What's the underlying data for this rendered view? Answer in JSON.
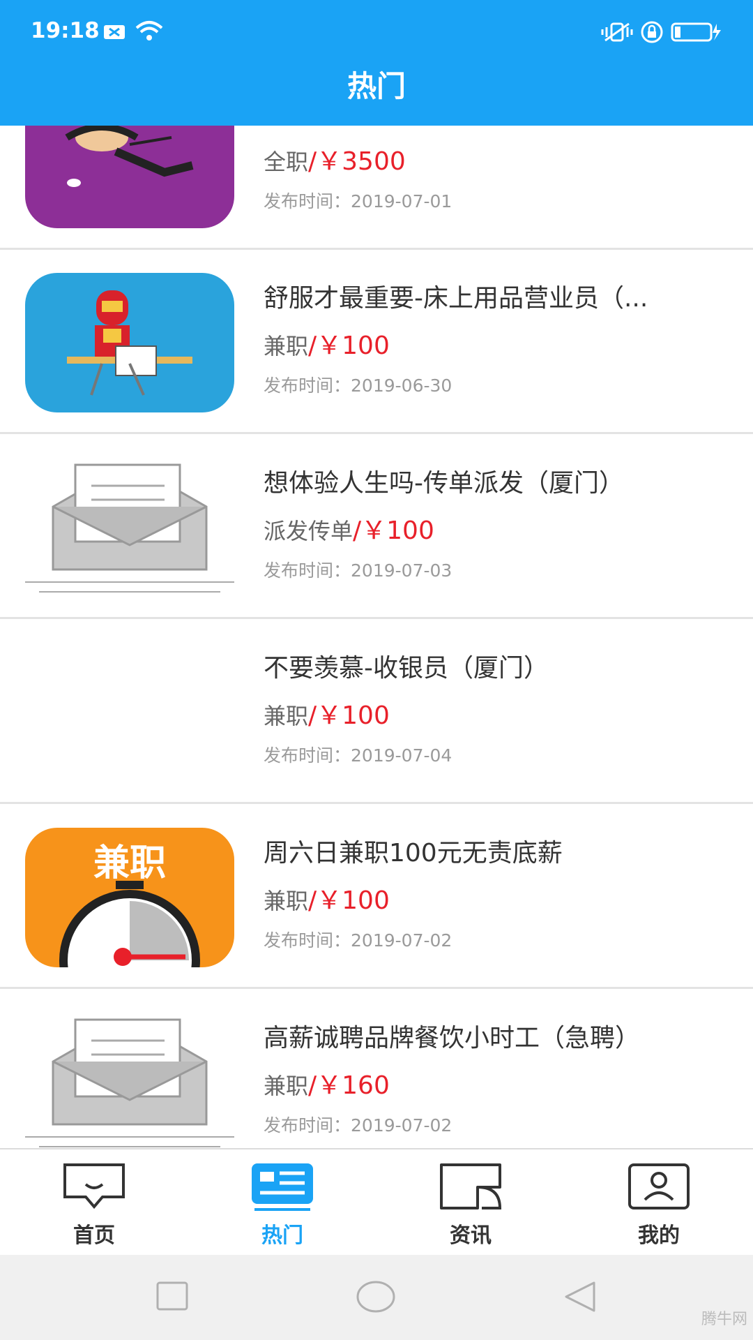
{
  "status": {
    "time": "19:18"
  },
  "header": {
    "title": "热门"
  },
  "jobs": [
    {
      "title": "",
      "type": "全职",
      "sep": "/",
      "price": "￥3500",
      "date_label": "发布时间：",
      "date": "2019-07-01",
      "thumb": "ninja-cartoon"
    },
    {
      "title": "舒服才最重要-床上用品营业员（...",
      "type": "兼职",
      "sep": "/",
      "price": "￥100",
      "date_label": "发布时间：",
      "date": "2019-06-30",
      "thumb": "ironman-ironing"
    },
    {
      "title": "想体验人生吗-传单派发（厦门）",
      "type": "派发传单",
      "sep": "/",
      "price": "￥100",
      "date_label": "发布时间：",
      "date": "2019-07-03",
      "thumb": "envelope"
    },
    {
      "title": "不要羡慕-收银员（厦门）",
      "type": "兼职",
      "sep": "/",
      "price": "￥100",
      "date_label": "发布时间：",
      "date": "2019-07-04",
      "thumb": "none"
    },
    {
      "title": "周六日兼职100元无责底薪",
      "type": "兼职",
      "sep": "/",
      "price": "￥100",
      "date_label": "发布时间：",
      "date": "2019-07-02",
      "thumb": "parttime-stopwatch",
      "thumb_text": "兼职"
    },
    {
      "title": "高薪诚聘品牌餐饮小时工（急聘）",
      "type": "兼职",
      "sep": "/",
      "price": "￥160",
      "date_label": "发布时间：",
      "date": "2019-07-02",
      "thumb": "envelope"
    }
  ],
  "tabs": [
    {
      "label": "首页",
      "icon": "chat-bubble-icon",
      "active": false
    },
    {
      "label": "热门",
      "icon": "news-card-icon",
      "active": true
    },
    {
      "label": "资讯",
      "icon": "info-window-icon",
      "active": false
    },
    {
      "label": "我的",
      "icon": "profile-card-icon",
      "active": false
    }
  ],
  "colors": {
    "primary": "#1aa3f5",
    "price": "#e8202a"
  },
  "watermark": "腾牛网"
}
